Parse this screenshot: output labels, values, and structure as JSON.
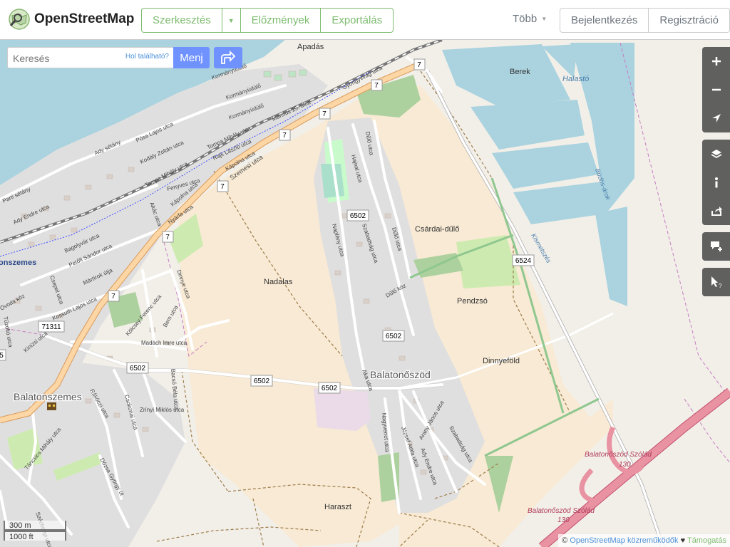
{
  "header": {
    "logo_text": "OpenStreetMap",
    "edit_label": "Szerkesztés",
    "history_label": "Előzmények",
    "export_label": "Exportálás",
    "more_label": "Több",
    "login_label": "Bejelentkezés",
    "signup_label": "Regisztráció"
  },
  "search": {
    "placeholder": "Keresés",
    "where_label": "Hol található?",
    "go_label": "Menj"
  },
  "map": {
    "places": {
      "apadas": "Apadás",
      "berek": "Berek",
      "halasto": "Halastó",
      "csardai_dulo": "Csárdai-dűlő",
      "nadalas": "Nadalas",
      "pendzso": "Pendzsó",
      "dinnyefold": "Dinnyeföld",
      "balatonoszod": "Balatonőszöd",
      "balatonszemes": "Balatonszemes",
      "balatonszemes_partial": "onszemes",
      "haraszt": "Haraszt",
      "station1": "Balatonőszöd Szólád",
      "station2": "Balatonőszöd Szólád",
      "hwy_130a": "130",
      "hwy_130b": "130",
      "buldos": "Büdös-árok",
      "kismetszes": "Kismetszés"
    },
    "road_shields": [
      "7",
      "7",
      "7",
      "7",
      "7",
      "7",
      "7",
      "6502",
      "6502",
      "6502",
      "6502",
      "6524",
      "71311",
      "5"
    ],
    "streets": {
      "kormanyudulo1": "Kormányüdülő",
      "kormanyudulo2": "Kormányüdülő",
      "kormanyudulo3": "Kormányüdülő",
      "gyongyvirag": "Gyöngyvirág utca",
      "marcius15": "Március 15. utca",
      "ady_setany": "Ady sétány",
      "posa_lajos": "Pósa Lajos utca",
      "kodaly": "Kodály Zoltán utca",
      "tompa1": "Tompa Mihály utca",
      "tompa2": "Tompa Mihály utca",
      "rajk": "Rajk László utca",
      "kapolna1": "Kápolna utca",
      "kapolna2": "Kápolna utca",
      "szemesi": "Szemesi utca",
      "fenyves": "Fenyves utca",
      "parti_setany": "Parti sétány",
      "ady_endre": "Ady Endre utca",
      "nyarfa": "Nyárfa utca",
      "akac": "Akác utca",
      "bagolyvar": "Bagolyvár utca",
      "petofi": "Petőfi Sándor utca",
      "martirok": "Mártírok útja",
      "ovoda": "Óvoda köz",
      "csepel": "Csepel utca",
      "kossuth": "Kossuth Lajos utca",
      "kolcsey": "Kölcsey Ferenc utca",
      "tuzolto": "Tűzoltó utca",
      "kinizsi": "Kinizsi utca",
      "madach": "Madách Imre utca",
      "bem": "Bem utca",
      "dinnye": "Dinnye utca",
      "hajnal": "Hajnal utca",
      "dulo1": "Dűlő utca",
      "dulo2": "Dűlő utca",
      "szabadsag1": "Szabadság utca",
      "szabadsag2": "Szabadság utca",
      "napfeny": "Napfény utca",
      "dulo_koz": "Dűlő köz",
      "aka": "Aka utca",
      "bacso": "Bacsó Béla utca",
      "rakoczi": "Rákóczi utca",
      "csokonai": "Csokonai utca",
      "zrinyi": "Zrínyi Miklós utca",
      "tancsics": "Táncsics Mihály utca",
      "dozsa": "Dózsa György út",
      "szechenyi": "Széchenyi utca",
      "nagyvenct": "Nagyvenct utca",
      "jozsef_attila": "József Attila utca",
      "arany": "Arany János utca",
      "ady2": "Ady Endre utca"
    }
  },
  "scale": {
    "metric": "300 m",
    "imperial": "1000 ft"
  },
  "attribution": {
    "prefix": "©",
    "link": "OpenStreetMap közreműködők",
    "heart": "♥",
    "support": "Támogatás"
  },
  "colors": {
    "brand_green": "#7ebc6f",
    "search_blue": "#7092ff",
    "water": "#aad3df",
    "farmland": "#f8ead4",
    "residential": "#e0dfdf",
    "primary_road": "#fcd6a4",
    "motorway": "#e892a2"
  }
}
